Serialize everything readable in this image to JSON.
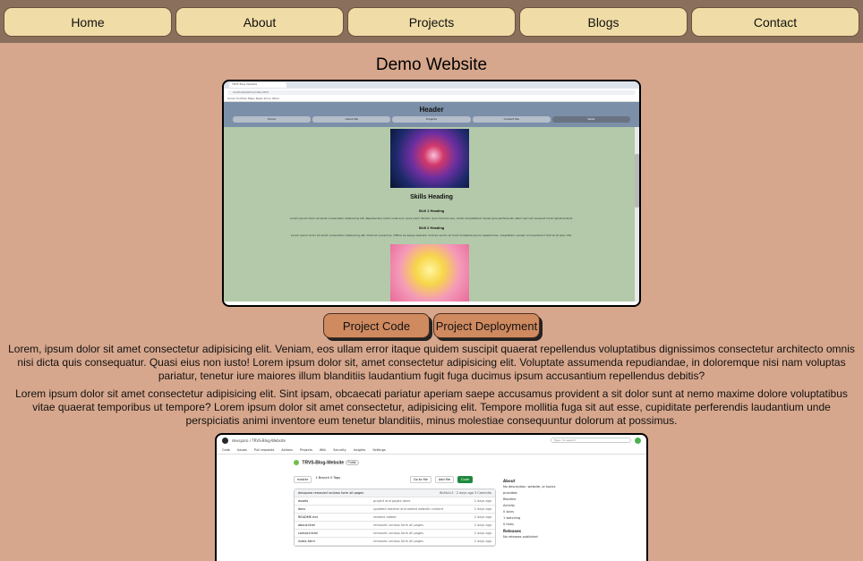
{
  "nav": {
    "items": [
      "Home",
      "About",
      "Projects",
      "Blogs",
      "Contact"
    ]
  },
  "page": {
    "title": "Demo Website"
  },
  "preview1": {
    "tab_label": "TRVS Blog Website",
    "url": "localhost/demo/index.html",
    "bookmarks": "Gmail  YouTube  Maps  News  Drive  Other",
    "site_header": "Header",
    "site_nav": [
      "Home",
      "About Me",
      "Projects",
      "Contact Me",
      "Skills"
    ],
    "skills_heading": "Skills Heading",
    "skill1_heading": "Skill 1 Heading",
    "skill1_text": "Lorem ipsum dolor sit amet consectetur adipisicing elit. Repellendus animi nulla eum quos odio? Tenetur quis maxime eos. Amet voluptatibus? Quasi quia perferendis ullam sed rem quaerat modi reprehenderit.",
    "skill2_heading": "Skill 2 Heading",
    "skill2_text": "Lorem ipsum dolor sit amet consectetur adipisicing elit. Dolorum possimus. Officia ea eaque aperiam dolores vel illo et modi molestias ipsum repellendus, voluptatem veniam accusantium? Sint et at ipsa nihil."
  },
  "buttons": {
    "code": "Project Code",
    "deploy": "Project Deployment"
  },
  "paragraphs": {
    "p1": "Lorem, ipsum dolor sit amet consectetur adipisicing elit. Veniam, eos ullam error itaque quidem suscipit quaerat repellendus voluptatibus dignissimos consectetur architecto omnis nisi dicta quis consequatur. Quasi eius non iusto! Lorem ipsum dolor sit, amet consectetur adipisicing elit. Voluptate assumenda repudiandae, in doloremque nisi nam voluptas pariatur, tenetur iure maiores illum blanditiis laudantium fugit fuga ducimus ipsum accusantium repellendus debitis?",
    "p2": "Lorem ipsum dolor sit amet consectetur adipisicing elit. Sint ipsam, obcaecati pariatur aperiam saepe accusamus provident a sit dolor sunt at nemo maxime dolore voluptatibus vitae quaerat temporibus ut tempore? Lorem ipsum dolor sit amet consectetur, adipisicing elit. Tempore mollitia fuga sit aut esse, cupiditate perferendis laudantium unde perspiciatis animi inventore eum tenetur blanditiis, minus molestiae consequuntur dolorum at possimus."
  },
  "preview2": {
    "breadcrumb": "devsparo / TRVS-Blog-Website",
    "search": "Type / to search",
    "tabs": [
      "Code",
      "Issues",
      "Pull requests",
      "Actions",
      "Projects",
      "Wiki",
      "Security",
      "Insights",
      "Settings"
    ],
    "repo_name": "TRVS-Blog-Website",
    "visibility": "Public",
    "branch": "master",
    "branch_info": "1 Branch  0 Tags",
    "goto_file": "Go to file",
    "add_file": "Add file",
    "code_btn": "Code",
    "commit_head": "devsparo  removed unclass form all pages",
    "commit_meta": "6b5b1c3 · 2 days ago  3 Commits",
    "files": [
      {
        "name": "assets",
        "msg": "project and pages done",
        "time": "2 days ago"
      },
      {
        "name": "docs",
        "msg": "updated readme and added website content",
        "time": "2 days ago"
      },
      {
        "name": "README.md",
        "msg": "readme added",
        "time": "2 days ago"
      },
      {
        "name": "about.html",
        "msg": "removed unclass form all pages",
        "time": "2 days ago"
      },
      {
        "name": "contact.html",
        "msg": "removed unclass form all pages",
        "time": "2 days ago"
      },
      {
        "name": "index.html",
        "msg": "removed unclass form all pages",
        "time": "2 days ago"
      }
    ],
    "about_title": "About",
    "about_text": "No description, website, or topics provided.",
    "about_items": [
      "Readme",
      "Activity",
      "0 stars",
      "1 watching",
      "0 forks"
    ],
    "releases_title": "Releases",
    "releases_text": "No releases published"
  }
}
